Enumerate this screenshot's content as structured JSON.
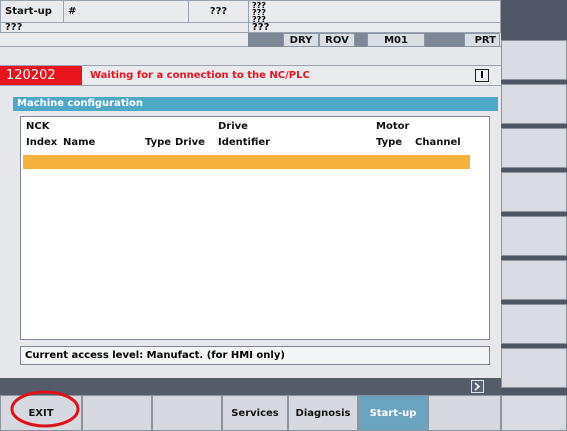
{
  "header": {
    "area": "Start-up",
    "program_prefix": "#",
    "program_value": "???",
    "channel_line1": "???",
    "channel_line2": "???",
    "channel_line3": "???",
    "row2_left": "???",
    "row2_right": "???",
    "status_boxes": [
      "DRY",
      "ROV",
      "M01",
      "PRT"
    ]
  },
  "alarm": {
    "number": "120202",
    "text": "Waiting for a connection to the NC/PLC",
    "indicator": "I"
  },
  "panel": {
    "title": "Machine configuration",
    "columns_row1": {
      "nck": "NCK",
      "drive": "Drive",
      "motor": "Motor"
    },
    "columns_row2": {
      "index": "Index",
      "name": "Name",
      "type": "Type",
      "drive": "Drive",
      "identifier": "Identifier",
      "motor_type": "Type",
      "channel": "Channel"
    },
    "access_level": "Current access level: Manufact. (for HMI only)"
  },
  "softkeys": {
    "horizontal": [
      "EXIT",
      "",
      "",
      "Services",
      "Diagnosis",
      "Start-up",
      ""
    ],
    "active_index": 5,
    "next_icon": "chevron-right-icon"
  },
  "colors": {
    "panel_title": "#4fa8c5",
    "alarm_number_bg": "#e8141b",
    "alarm_text": "#e8141b",
    "highlight_row": "#f7b23d",
    "annotation_circle": "#e0101a",
    "active_softkey": "#6aa4bf"
  }
}
